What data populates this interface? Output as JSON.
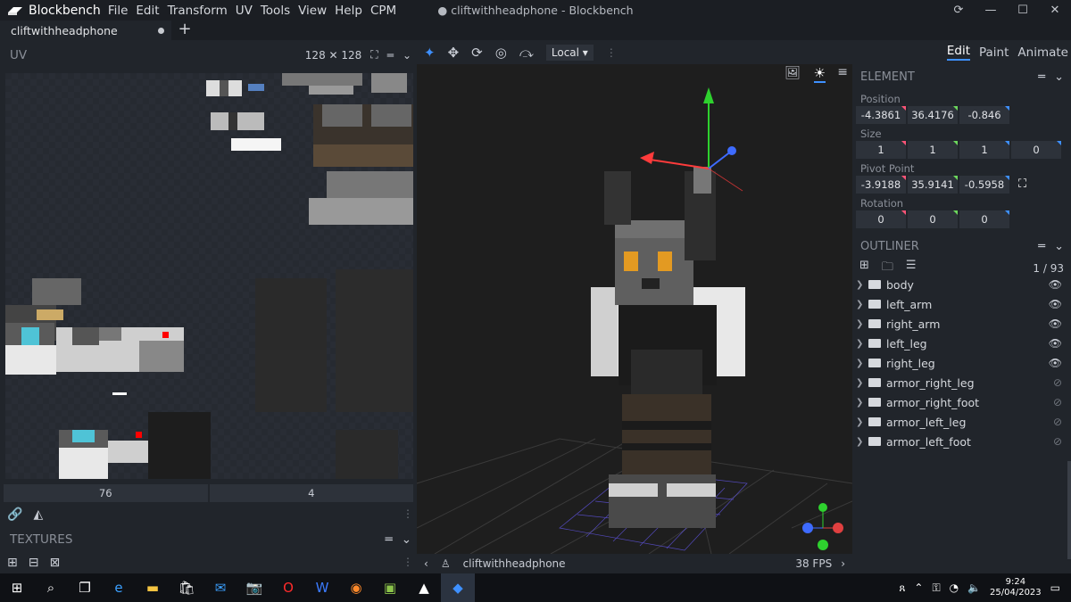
{
  "app": {
    "name": "Blockbench",
    "window_title": "● cliftwithheadphone - Blockbench",
    "menu": [
      "File",
      "Edit",
      "Transform",
      "UV",
      "Tools",
      "View",
      "Help",
      "CPM"
    ]
  },
  "tabs": [
    {
      "label": "cliftwithheadphone"
    }
  ],
  "uv": {
    "title": "UV",
    "size_label": "128 ✕ 128",
    "inputs": [
      "76",
      "4"
    ]
  },
  "textures": {
    "title": "TEXTURES"
  },
  "viewport": {
    "transform_space": "Local",
    "model_name": "cliftwithheadphone",
    "fps": "38 FPS"
  },
  "modes": {
    "edit": "Edit",
    "paint": "Paint",
    "animate": "Animate"
  },
  "element": {
    "title": "ELEMENT",
    "position_label": "Position",
    "position": [
      "-4.3861",
      "36.4176",
      "-0.846"
    ],
    "size_label": "Size",
    "size": [
      "1",
      "1",
      "1",
      "0"
    ],
    "pivot_label": "Pivot Point",
    "pivot": [
      "-3.9188",
      "35.9141",
      "-0.5958"
    ],
    "rotation_label": "Rotation",
    "rotation": [
      "0",
      "0",
      "0"
    ]
  },
  "outliner": {
    "title": "OUTLINER",
    "count": "1 / 93",
    "items": [
      {
        "label": "body",
        "visible": true
      },
      {
        "label": "left_arm",
        "visible": true
      },
      {
        "label": "right_arm",
        "visible": true
      },
      {
        "label": "left_leg",
        "visible": true
      },
      {
        "label": "right_leg",
        "visible": true
      },
      {
        "label": "armor_right_leg",
        "visible": false
      },
      {
        "label": "armor_right_foot",
        "visible": false
      },
      {
        "label": "armor_left_leg",
        "visible": false
      },
      {
        "label": "armor_left_foot",
        "visible": false
      }
    ]
  },
  "taskbar": {
    "time": "9:24",
    "date": "25/04/2023"
  },
  "colors": {
    "accent": "#3e90ff",
    "axis_x": "#ff5477",
    "axis_y": "#6cd85c",
    "axis_z": "#3e90ff"
  }
}
